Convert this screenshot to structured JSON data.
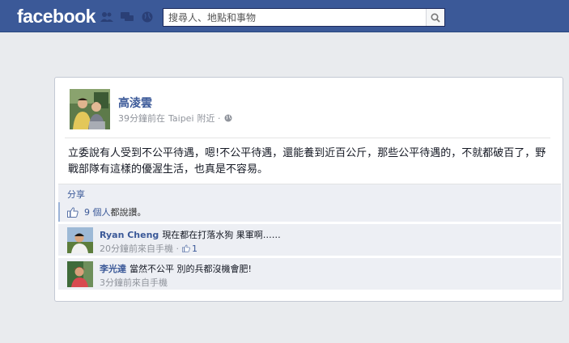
{
  "topbar": {
    "logo": "facebook",
    "search_placeholder": "搜尋人、地點和事物",
    "jewel_icons": [
      "friends-icon",
      "messages-icon",
      "notifications-globe-icon"
    ]
  },
  "post": {
    "author": "高淩雲",
    "time": "39分鐘前在",
    "location": "Taipei",
    "location_suffix": "附近 ·",
    "text": "立委說有人受到不公平待遇，嗯!不公平待遇，還能養到近百公斤，那些公平待遇的，不就都破百了，野戰部隊有這樣的優渥生活，也真是不容易。",
    "share_label": "分享"
  },
  "likes": {
    "count": "9 個人",
    "suffix": "都說讚。"
  },
  "comments": [
    {
      "name": "Ryan Cheng",
      "text": "現在都在打落水狗 果軍啊……",
      "meta": "20分鐘前來自手機 ·",
      "likes": "1"
    },
    {
      "name": "李光達",
      "text": "當然不公平 別的兵都沒機會肥!",
      "meta": "3分鐘前來自手機"
    }
  ],
  "colors": {
    "brand": "#3b5998",
    "background": "#e9ebee",
    "comment_bg": "#edeff4"
  }
}
